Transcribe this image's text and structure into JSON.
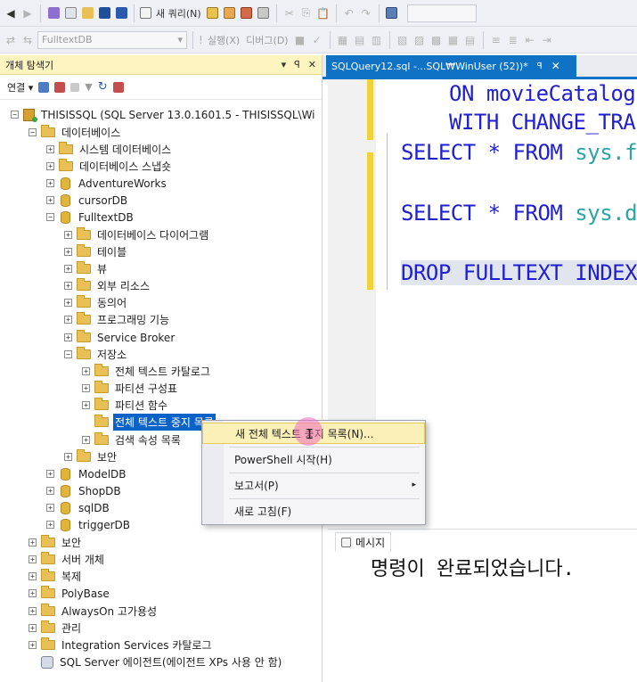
{
  "toolbar1": {
    "new_query_label": "새 쿼리(N)",
    "icons": [
      "new-icon",
      "open-icon",
      "save-icon",
      "save-all-icon",
      "undo-icon",
      "redo-icon",
      "activity-monitor-icon"
    ]
  },
  "toolbar2": {
    "database_combo": "FulltextDB",
    "execute_label": "실행(X)",
    "debug_label": "디버그(D)"
  },
  "object_explorer": {
    "title": "개체 탐색기",
    "pin_glyph": "▾ ꟼ ✕",
    "connect_label": "연결",
    "server_label": "THISISSQL (SQL Server 13.0.1601.5 - THISISSQL\\Wi",
    "tree": [
      {
        "label": "데이터베이스",
        "expander": "⊟"
      },
      {
        "label": "시스템 데이터베이스",
        "expander": "⊞"
      },
      {
        "label": "데이터베이스 스냅숏",
        "expander": "⊞"
      },
      {
        "label": "AdventureWorks",
        "expander": "⊞"
      },
      {
        "label": "cursorDB",
        "expander": "⊞"
      },
      {
        "label": "FulltextDB",
        "expander": "⊟"
      },
      {
        "label": "데이터베이스 다이어그램",
        "expander": "⊞"
      },
      {
        "label": "테이블",
        "expander": "⊞"
      },
      {
        "label": "뷰",
        "expander": "⊞"
      },
      {
        "label": "외부 리소스",
        "expander": "⊞"
      },
      {
        "label": "동의어",
        "expander": "⊞"
      },
      {
        "label": "프로그래밍 기능",
        "expander": "⊞"
      },
      {
        "label": "Service Broker",
        "expander": "⊞"
      },
      {
        "label": "저장소",
        "expander": "⊟"
      },
      {
        "label": "전체 텍스트 카탈로그",
        "expander": "⊞"
      },
      {
        "label": "파티션 구성표",
        "expander": "⊞"
      },
      {
        "label": "파티션 함수",
        "expander": "⊞"
      },
      {
        "label": "전체 텍스트 중지 목록",
        "expander": ""
      },
      {
        "label": "검색 속성 목록",
        "expander": "⊞"
      },
      {
        "label": "보안",
        "expander": "⊞"
      },
      {
        "label": "ModelDB",
        "expander": "⊞"
      },
      {
        "label": "ShopDB",
        "expander": "⊞"
      },
      {
        "label": "sqlDB",
        "expander": "⊞"
      },
      {
        "label": "triggerDB",
        "expander": "⊞"
      },
      {
        "label": "보안",
        "expander": "⊞"
      },
      {
        "label": "서버 개체",
        "expander": "⊞"
      },
      {
        "label": "복제",
        "expander": "⊞"
      },
      {
        "label": "PolyBase",
        "expander": "⊞"
      },
      {
        "label": "AlwaysOn 고가용성",
        "expander": "⊞"
      },
      {
        "label": "관리",
        "expander": "⊞"
      },
      {
        "label": "Integration Services 카탈로그",
        "expander": "⊞"
      },
      {
        "label": "SQL Server 에이전트(에이전트 XPs 사용 안 함)",
        "expander": ""
      }
    ]
  },
  "editor": {
    "tab_label": "SQLQuery12.sql -...SQL₩WinUser (52))*",
    "tab_pin": "ꟼ",
    "tab_close": "✕",
    "lines": {
      "l1_kw": "ON",
      "l1_rest": " movieCatalog",
      "l2": "WITH CHANGE_TRA",
      "l3_kw": "SELECT * FROM",
      "l3_tbl": " sys.f",
      "l4_kw": "SELECT * FROM",
      "l4_tbl": " sys.d",
      "l5": "DROP FULLTEXT INDEX"
    }
  },
  "results": {
    "tab_label": "메시지",
    "message": "명령이 완료되었습니다."
  },
  "context_menu": {
    "items": [
      {
        "label": "새 전체 텍스트 중지 목록(N)..."
      },
      {
        "label": "PowerShell 시작(H)"
      },
      {
        "label": "보고서(P)",
        "submenu_arrow": "▸"
      },
      {
        "label": "새로 고침(F)"
      }
    ]
  },
  "colors": {
    "explorer_title_bg": "#fdf4bf",
    "tab_active": "#0f72c4",
    "selection": "#0b63c8",
    "keyword": "#1f1fd0",
    "system_table": "#2aa5a5",
    "change_bar": "#f2d23b"
  }
}
